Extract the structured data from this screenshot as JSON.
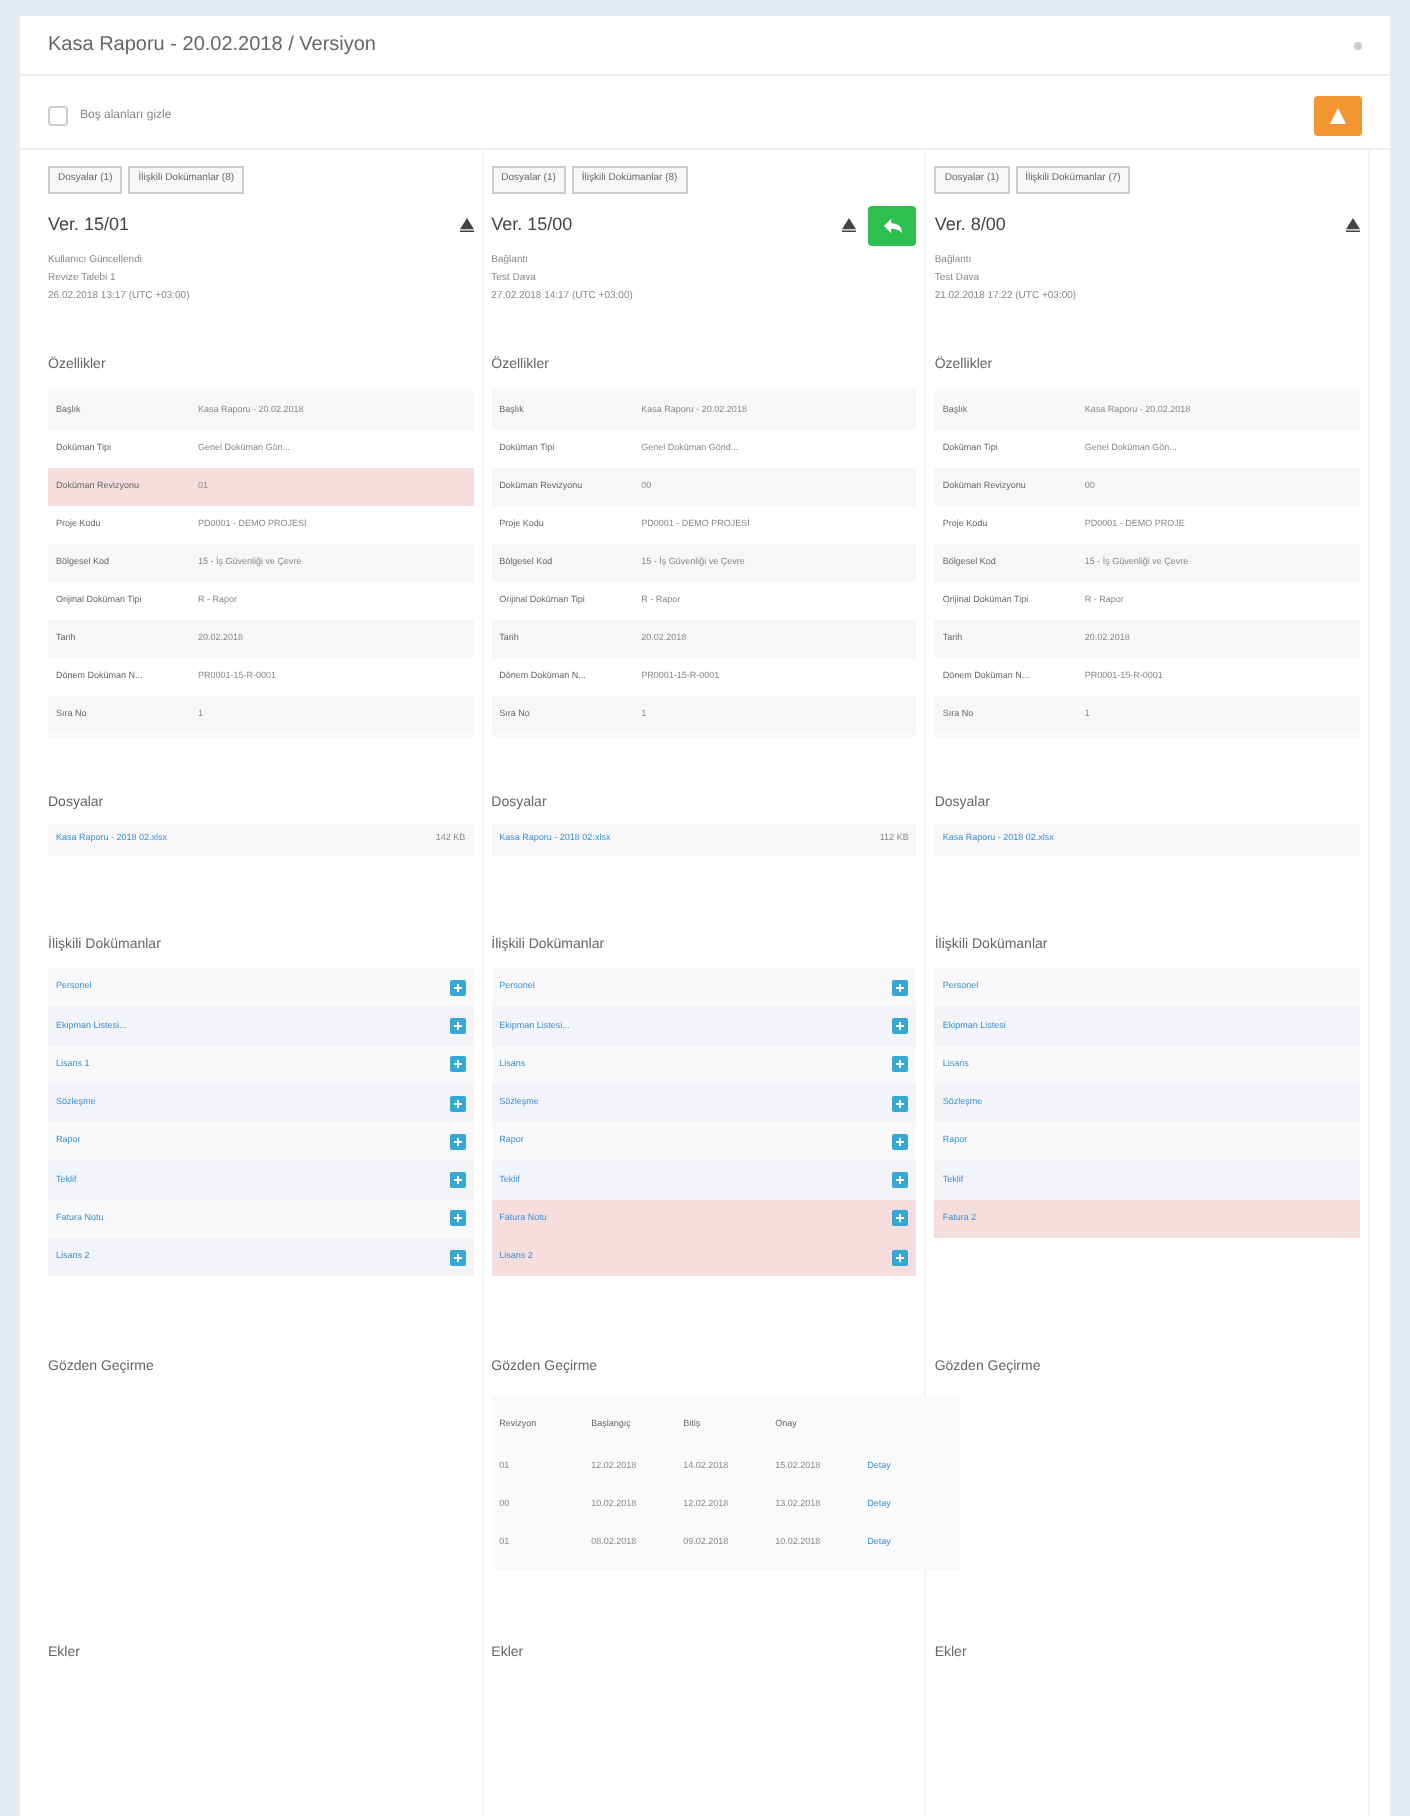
{
  "window": {
    "title": "Kasa Raporu - 20.02.2018 / Versiyon"
  },
  "hide_empty": {
    "label": "Boş alanları gizle",
    "checked": false
  },
  "columns": [
    {
      "tabs": [
        {
          "label": "Dosyalar (1)",
          "selected": false
        },
        {
          "label": "İlişkili Dokümanlar (8)",
          "selected": false
        }
      ],
      "version": "Ver. 15/01",
      "restore": false,
      "meta": [
        "Kullanıcı Güncellendi",
        "Revize Talebi 1",
        "26.02.2018 13:17 (UTC +03:00)"
      ],
      "properties_title": "Özellikler",
      "properties": [
        {
          "label": "Başlık",
          "value": "Kasa Raporu - 20.02.2018",
          "changed": false
        },
        {
          "label": "Doküman Tipi",
          "value": "Genel Doküman Gön...",
          "changed": false
        },
        {
          "label": "Doküman Revizyonu",
          "value": "01",
          "changed": true
        },
        {
          "label": "Proje Kodu",
          "value": "PD0001 - DEMO PROJESİ",
          "changed": false
        },
        {
          "label": "Bölgesel Kod",
          "value": "15 - İş Güvenliği ve Çevre",
          "changed": false
        },
        {
          "label": "Orijinal Doküman Tipi",
          "value": "R - Rapor",
          "changed": false
        },
        {
          "label": "Tarih",
          "value": "20.02.2018",
          "changed": false
        },
        {
          "label": "Dönem Doküman N...",
          "value": "PR0001-15-R-0001",
          "changed": false
        },
        {
          "label": "Sıra No",
          "value": "1",
          "changed": false
        }
      ],
      "files_title": "Dosyalar",
      "files": [
        {
          "name": "Kasa Raporu - 2018 02.xlsx",
          "size": "142 KB"
        }
      ],
      "related_title": "İlişkili Dokümanlar",
      "related": [
        {
          "name": "Personel",
          "changed": false,
          "link": true
        },
        {
          "name": "Ekipman Listesi...",
          "changed": false,
          "link": true
        },
        {
          "name": "Lisans 1",
          "changed": false,
          "link": true
        },
        {
          "name": "Sözleşme",
          "changed": false,
          "link": true
        },
        {
          "name": "Rapor",
          "changed": false,
          "link": true
        },
        {
          "name": "Teklif",
          "changed": false,
          "link": true
        },
        {
          "name": "Fatura Notu",
          "changed": false,
          "link": true
        },
        {
          "name": "Lisans 2",
          "changed": false,
          "link": true
        }
      ],
      "review_title": "Gözden Geçirme",
      "attachments_title": "Ekler"
    },
    {
      "tabs": [
        {
          "label": "Dosyalar (1)",
          "selected": false
        },
        {
          "label": "İlişkili Dokümanlar (8)",
          "selected": false
        }
      ],
      "version": "Ver. 15/00",
      "restore": true,
      "meta": [
        "Bağlantı",
        "Test Dava",
        "27.02.2018 14:17 (UTC +03:00)"
      ],
      "properties_title": "Özellikler",
      "properties": [
        {
          "label": "Başlık",
          "value": "Kasa Raporu - 20.02.2018",
          "changed": false
        },
        {
          "label": "Doküman Tipi",
          "value": "Genel Doküman Gönd...",
          "changed": false
        },
        {
          "label": "Doküman Revizyonu",
          "value": "00",
          "changed": false
        },
        {
          "label": "Proje Kodu",
          "value": "PD0001 - DEMO PROJESİ",
          "changed": false
        },
        {
          "label": "Bölgesel Kod",
          "value": "15 - İş Güvenliği ve Çevre",
          "changed": false
        },
        {
          "label": "Orijinal Doküman Tipi",
          "value": "R - Rapor",
          "changed": false
        },
        {
          "label": "Tarih",
          "value": "20.02.2018",
          "changed": false
        },
        {
          "label": "Dönem Doküman N...",
          "value": "PR0001-15-R-0001",
          "changed": false
        },
        {
          "label": "Sıra No",
          "value": "1",
          "changed": false
        }
      ],
      "files_title": "Dosyalar",
      "files": [
        {
          "name": "Kasa Raporu - 2018 02.xlsx",
          "size": "112 KB"
        }
      ],
      "related_title": "İlişkili Dokümanlar",
      "related": [
        {
          "name": "Personel",
          "changed": false,
          "link": true
        },
        {
          "name": "Ekipman Listesi...",
          "changed": false,
          "link": true
        },
        {
          "name": "Lisans",
          "changed": false,
          "link": true
        },
        {
          "name": "Sözleşme",
          "changed": false,
          "link": true
        },
        {
          "name": "Rapor",
          "changed": false,
          "link": true
        },
        {
          "name": "Teklif",
          "changed": false,
          "link": true
        },
        {
          "name": "Fatura Notu",
          "changed": true,
          "link": true
        },
        {
          "name": "Lisans 2",
          "changed": true,
          "link": true
        }
      ],
      "review_title": "Gözden Geçirme",
      "review": {
        "columns": [
          "Revizyon",
          "Başlangıç",
          "Bitiş",
          "Onay"
        ],
        "rows": [
          {
            "cells": [
              "01",
              "12.02.2018",
              "14.02.2018",
              "15.02.2018"
            ],
            "action": "Detay"
          },
          {
            "cells": [
              "00",
              "10.02.2018",
              "12.02.2018",
              "13.02.2018"
            ],
            "action": "Detay"
          },
          {
            "cells": [
              "01",
              "08.02.2018",
              "09.02.2018",
              "10.02.2018"
            ],
            "action": "Detay"
          }
        ]
      },
      "attachments_title": "Ekler"
    },
    {
      "tabs": [
        {
          "label": "Dosyalar (1)",
          "selected": false
        },
        {
          "label": "İlişkili Dokümanlar (7)",
          "selected": false
        }
      ],
      "version": "Ver. 8/00",
      "restore": false,
      "meta": [
        "Bağlantı",
        "Test Dava",
        "21.02.2018 17:22 (UTC +03:00)"
      ],
      "properties_title": "Özellikler",
      "properties": [
        {
          "label": "Başlık",
          "value": "Kasa Raporu - 20.02.2018",
          "changed": false
        },
        {
          "label": "Doküman Tipi",
          "value": "Genel Doküman Gön...",
          "changed": false
        },
        {
          "label": "Doküman Revizyonu",
          "value": "00",
          "changed": false
        },
        {
          "label": "Proje Kodu",
          "value": "PD0001 - DEMO PROJE",
          "changed": false
        },
        {
          "label": "Bölgesel Kod",
          "value": "15 - İş Güvenliği ve Çevre",
          "changed": false
        },
        {
          "label": "Orijinal Doküman Tipi",
          "value": "R - Rapor",
          "changed": false
        },
        {
          "label": "Tarih",
          "value": "20.02.2018",
          "changed": false
        },
        {
          "label": "Dönem Doküman N...",
          "value": "PR0001-15-R-0001",
          "changed": false
        },
        {
          "label": "Sıra No",
          "value": "1",
          "changed": false
        }
      ],
      "files_title": "Dosyalar",
      "files": [
        {
          "name": "Kasa Raporu - 2018 02.xlsx"
        }
      ],
      "related_title": "İlişkili Dokümanlar",
      "related": [
        {
          "name": "Personel",
          "changed": false,
          "link": false
        },
        {
          "name": "Ekipman Listesi",
          "changed": false,
          "link": false
        },
        {
          "name": "Lisans",
          "changed": false,
          "link": false
        },
        {
          "name": "Sözleşme",
          "changed": false,
          "link": false
        },
        {
          "name": "Rapor",
          "changed": false,
          "link": false
        },
        {
          "name": "Teklif",
          "changed": false,
          "link": false
        },
        {
          "name": "Fatura 2",
          "changed": true,
          "link": false
        }
      ],
      "review_title": "Gözden Geçirme",
      "attachments_title": "Ekler"
    }
  ]
}
